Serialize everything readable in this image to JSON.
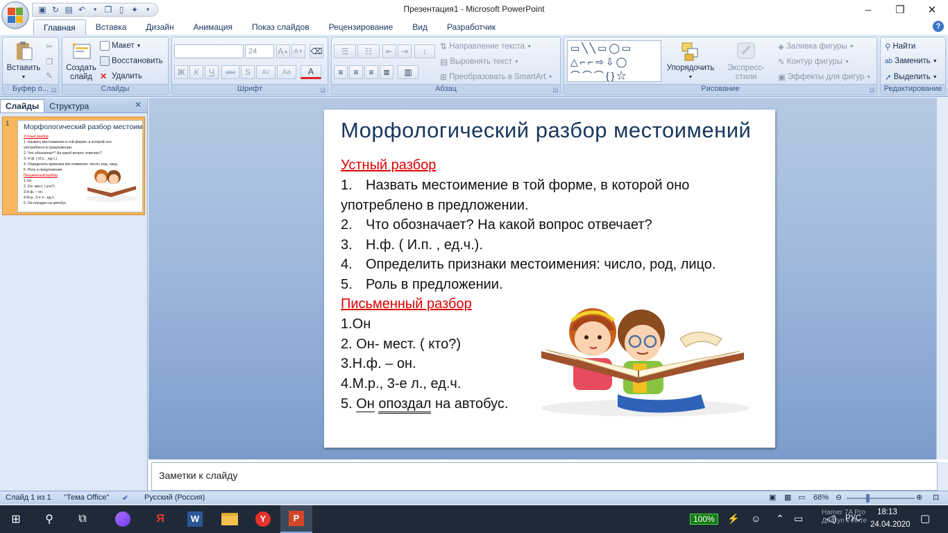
{
  "window": {
    "title": "Презентация1 - Microsoft PowerPoint"
  },
  "tabs": [
    "Главная",
    "Вставка",
    "Дизайн",
    "Анимация",
    "Показ слайдов",
    "Рецензирование",
    "Вид",
    "Разработчик"
  ],
  "ribbon": {
    "clipboard": {
      "paste": "Вставить",
      "label": "Буфер о..."
    },
    "slides": {
      "new_slide": "Создать слайд",
      "layout": "Макет",
      "reset": "Восстановить",
      "delete": "Удалить",
      "label": "Слайды"
    },
    "font": {
      "size": "24",
      "bold": "Ж",
      "italic": "К",
      "underline": "Ч",
      "strike": "abc",
      "shadow": "S",
      "spacing": "AV",
      "case": "Aa",
      "label": "Шрифт"
    },
    "paragraph": {
      "text_direction": "Направление текста",
      "align_text": "Выровнять текст",
      "smartart": "Преобразовать в SmartArt",
      "label": "Абзац"
    },
    "drawing": {
      "arrange": "Упорядочить",
      "quick_styles": "Экспресс-стили",
      "fill": "Заливка фигуры",
      "outline": "Контур фигуры",
      "effects": "Эффекты для фигур",
      "label": "Рисование"
    },
    "editing": {
      "find": "Найти",
      "replace": "Заменить",
      "select": "Выделить",
      "label": "Редактирование"
    }
  },
  "left_panel": {
    "tab_slides": "Слайды",
    "tab_outline": "Структура",
    "slide_number": "1",
    "thumb_title": "Морфологический разбор местоимений",
    "thumb_lines": [
      {
        "text": "Устный разбор",
        "red": true
      },
      {
        "text": "1.    Назвать местоимение в той форме, в которой оно",
        "red": false
      },
      {
        "text": "употреблено в предложении.",
        "red": false
      },
      {
        "text": "2.    Что обозначает? На какой вопрос отвечает?",
        "red": false
      },
      {
        "text": "3.    Н.ф. ( И.п. , ед.ч.).",
        "red": false
      },
      {
        "text": "4.    Определить признаки местоимения: число, род, лицо.",
        "red": false
      },
      {
        "text": "5.    Роль в предложении.",
        "red": false
      },
      {
        "text": "Письменный разбор",
        "red": true
      },
      {
        "text": "1.Он",
        "red": false
      },
      {
        "text": "2. Он- мест. ( кто?)",
        "red": false
      },
      {
        "text": "3.Н.ф. – он.",
        "red": false
      },
      {
        "text": "4.М.р., 3-е л., ед.ч.",
        "red": false
      },
      {
        "text": "5. Он опоздал на автобус.",
        "red": false
      }
    ]
  },
  "slide": {
    "title": "Морфологический разбор местоимений",
    "oral_heading": "Устный разбор",
    "oral_items": [
      {
        "num": "1.",
        "text": "Назвать местоимение в той форме, в которой оно"
      },
      {
        "num": "",
        "text": "употреблено в предложении."
      },
      {
        "num": "2.",
        "text": "Что обозначает? На какой вопрос отвечает?"
      },
      {
        "num": "3.",
        "text": "Н.ф. ( И.п. , ед.ч.)."
      },
      {
        "num": "4.",
        "text": "Определить признаки местоимения: число, род, лицо."
      },
      {
        "num": "5.",
        "text": "Роль в предложении."
      }
    ],
    "written_heading": "Письменный разбор",
    "written_items": [
      "1.Он",
      "2. Он- мест. ( кто?)",
      "3.Н.ф. – он.",
      "4.М.р., 3-е л., ед.ч."
    ],
    "last_line": {
      "prefix": "5. ",
      "subject": "Он",
      "predicate": "опоздал",
      "rest": " на автобус."
    }
  },
  "notes": {
    "placeholder": "Заметки к слайду"
  },
  "status": {
    "slide_of": "Слайд 1 из 1",
    "theme": "\"Тема Office\"",
    "language": "Русский (Россия)",
    "zoom": "68%"
  },
  "taskbar": {
    "battery": "100%",
    "lang": "РУС",
    "time": "18:13",
    "date": "24.04.2020",
    "notify_line1": "Hamer 7A Pro",
    "notify_line2": "Доступ к Инте"
  }
}
